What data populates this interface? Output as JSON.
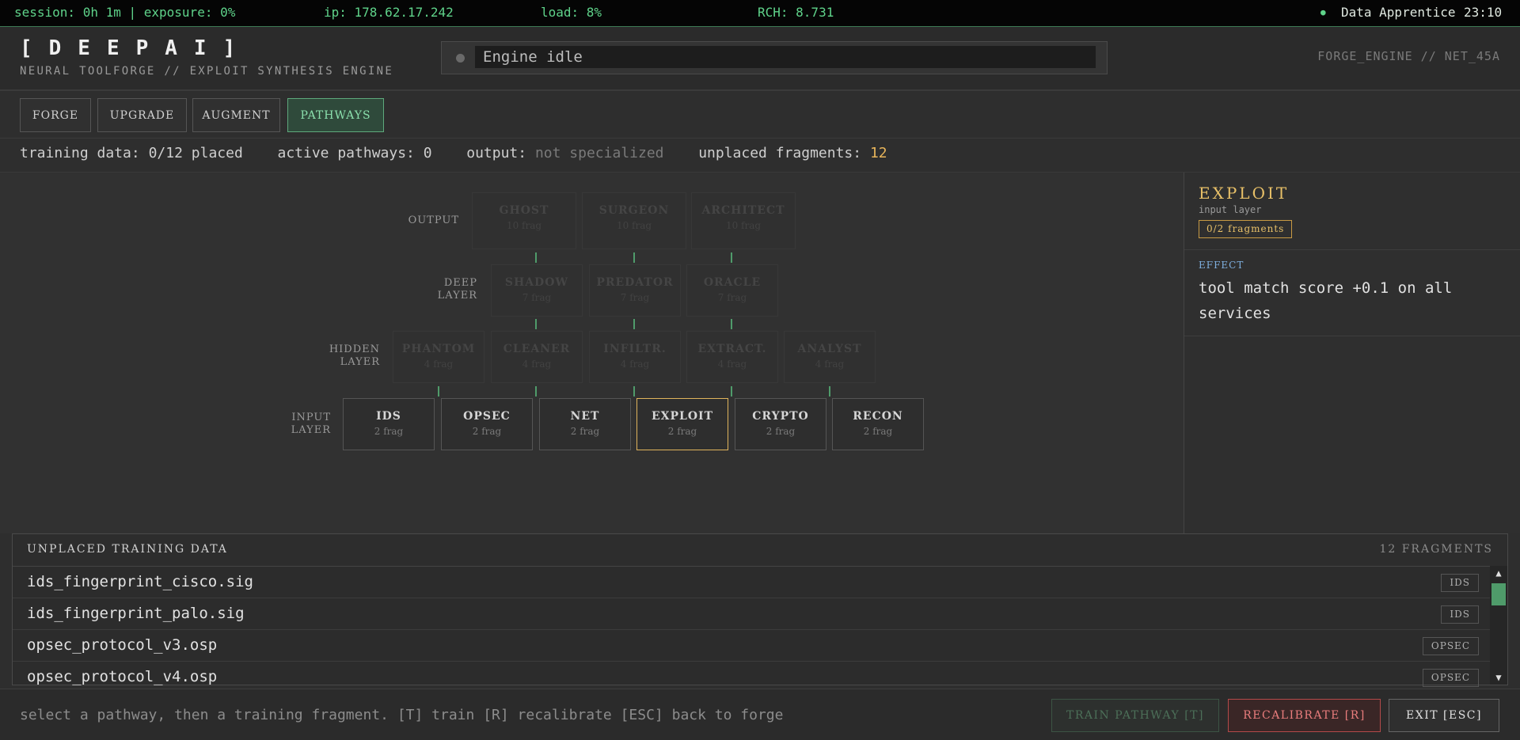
{
  "status_bar": {
    "session": "session: 0h 1m | exposure: 0%",
    "ip": "ip: 178.62.17.242",
    "load": "load: 8%",
    "rch": "RCH: 8.731",
    "dot": "●",
    "user": "Data Apprentice",
    "time": "23:10"
  },
  "header": {
    "logo": "[DEEPAI]",
    "tagline": "NEURAL TOOLFORGE // EXPLOIT SYNTHESIS ENGINE",
    "engine_status": "Engine idle",
    "forge_id": "FORGE_ENGINE // NET_45A"
  },
  "tabs": [
    {
      "label": "FORGE"
    },
    {
      "label": "UPGRADE"
    },
    {
      "label": "AUGMENT"
    },
    {
      "label": "PATHWAYS",
      "active": true
    }
  ],
  "stats": {
    "training_label": "training data:",
    "training_value": "0/12",
    "training_suffix": "placed",
    "pathways_label": "active pathways:",
    "pathways_value": "0",
    "output_label": "output:",
    "output_value": "not specialized",
    "unplaced_label": "unplaced fragments:",
    "unplaced_value": "12"
  },
  "network": {
    "layers": {
      "output": "OUTPUT",
      "deep": "DEEP\nLAYER",
      "hidden": "HIDDEN\nLAYER",
      "input": "INPUT\nLAYER"
    },
    "output_nodes": [
      {
        "name": "GHOST",
        "frag": "10 frag"
      },
      {
        "name": "SURGEON",
        "frag": "10 frag"
      },
      {
        "name": "ARCHITECT",
        "frag": "10 frag"
      }
    ],
    "deep_nodes": [
      {
        "name": "SHADOW",
        "frag": "7 frag"
      },
      {
        "name": "PREDATOR",
        "frag": "7 frag"
      },
      {
        "name": "ORACLE",
        "frag": "7 frag"
      }
    ],
    "hidden_nodes": [
      {
        "name": "PHANTOM",
        "frag": "4 frag"
      },
      {
        "name": "CLEANER",
        "frag": "4 frag"
      },
      {
        "name": "INFILTR.",
        "frag": "4 frag"
      },
      {
        "name": "EXTRACT.",
        "frag": "4 frag"
      },
      {
        "name": "ANALYST",
        "frag": "4 frag"
      }
    ],
    "input_nodes": [
      {
        "name": "IDS",
        "frag": "2 frag"
      },
      {
        "name": "OPSEC",
        "frag": "2 frag"
      },
      {
        "name": "NET",
        "frag": "2 frag"
      },
      {
        "name": "EXPLOIT",
        "frag": "2 frag",
        "selected": true
      },
      {
        "name": "CRYPTO",
        "frag": "2 frag"
      },
      {
        "name": "RECON",
        "frag": "2 frag"
      }
    ]
  },
  "side_panel": {
    "title": "EXPLOIT",
    "subtitle": "input layer",
    "badge": "0/2 fragments",
    "effect_label": "EFFECT",
    "effect_text": "tool match score +0.1 on all services"
  },
  "fragments": {
    "title": "UNPLACED TRAINING DATA",
    "count": "12 FRAGMENTS",
    "items": [
      {
        "name": "ids_fingerprint_cisco.sig",
        "tag": "IDS"
      },
      {
        "name": "ids_fingerprint_palo.sig",
        "tag": "IDS"
      },
      {
        "name": "opsec_protocol_v3.osp",
        "tag": "OPSEC"
      },
      {
        "name": "opsec_protocol_v4.osp",
        "tag": "OPSEC"
      }
    ],
    "scroll_up": "▲",
    "scroll_down": "▼"
  },
  "footer": {
    "hint": "select a pathway, then a training fragment. [T] train [R] recalibrate [ESC] back to forge",
    "train_label": "TRAIN PATHWAY [T]",
    "recal_label": "RECALIBRATE [R]",
    "exit_label": "EXIT [ESC]"
  },
  "colors": {
    "accent_green": "#5fd38a",
    "selected_gold": "#e0b45c",
    "danger_red": "#ea7d7d",
    "connector": "#4f9b6a"
  }
}
